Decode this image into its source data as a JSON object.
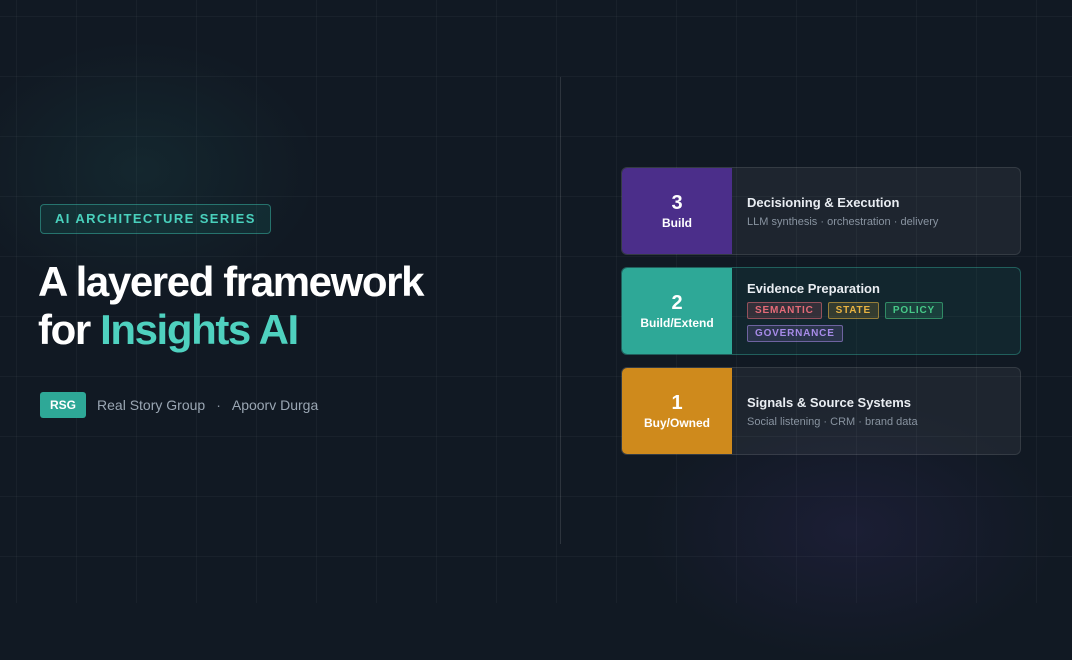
{
  "series_tag": "AI ARCHITECTURE SERIES",
  "headline": {
    "line1": "A layered framework",
    "line2_prefix": "for ",
    "line2_accent": "Insights AI"
  },
  "byline": {
    "badge": "RSG",
    "org": "Real Story Group",
    "separator": "·",
    "author": "Apoorv Durga"
  },
  "layers": [
    {
      "number": "3",
      "kind": "Build",
      "title": "Decisioning & Execution",
      "subtitle": "LLM synthesis · orchestration · delivery",
      "color": "#4b2e8a"
    },
    {
      "number": "2",
      "kind": "Build/Extend",
      "title": "Evidence Preparation",
      "chips": [
        "SEMANTIC",
        "STATE",
        "POLICY",
        "GOVERNANCE"
      ],
      "color": "#2ea897"
    },
    {
      "number": "1",
      "kind": "Buy/Owned",
      "title": "Signals & Source Systems",
      "subtitle": "Social listening · CRM · brand data",
      "color": "#cf8a1c"
    }
  ],
  "colors": {
    "accent": "#4fd1bf",
    "chip_semantic": "#e46b78",
    "chip_state": "#e8b341",
    "chip_policy": "#46c888",
    "chip_governance": "#a78be8"
  }
}
